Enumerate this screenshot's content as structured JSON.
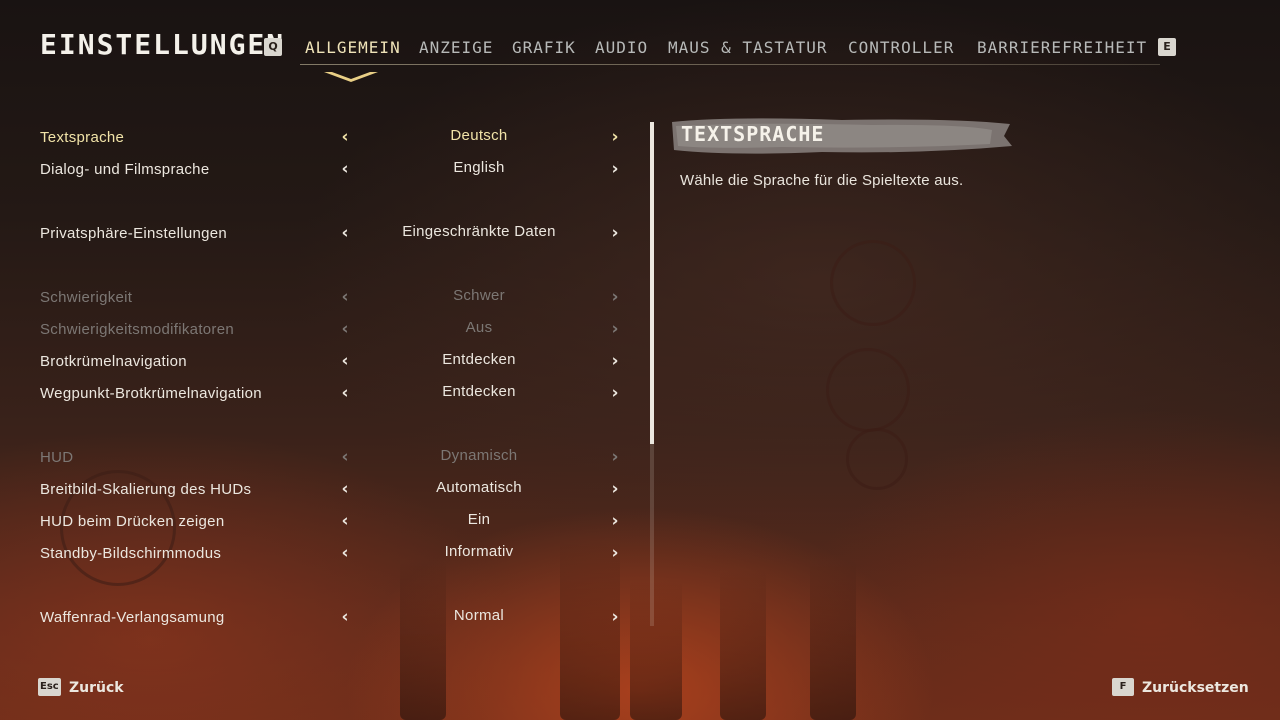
{
  "header": {
    "title": "EINSTELLUNGEN",
    "prev_tab_key": "Q",
    "next_tab_key": "E",
    "tabs": [
      {
        "label": "ALLGEMEIN",
        "active": true
      },
      {
        "label": "ANZEIGE",
        "active": false
      },
      {
        "label": "GRAFIK",
        "active": false
      },
      {
        "label": "AUDIO",
        "active": false
      },
      {
        "label": "MAUS & TASTATUR",
        "active": false
      },
      {
        "label": "CONTROLLER",
        "active": false
      },
      {
        "label": "BARRIEREFREIHEIT",
        "active": false
      }
    ]
  },
  "settings": [
    {
      "label": "Textsprache",
      "value": "Deutsch",
      "state": "selected"
    },
    {
      "label": "Dialog- und Filmsprache",
      "value": "English",
      "state": "normal"
    },
    {
      "label": "Privatsphäre-Einstellungen",
      "value": "Eingeschränkte Daten",
      "state": "normal"
    },
    {
      "label": "Schwierigkeit",
      "value": "Schwer",
      "state": "disabled"
    },
    {
      "label": "Schwierigkeitsmodifikatoren",
      "value": "Aus",
      "state": "disabled"
    },
    {
      "label": "Brotkrümelnavigation",
      "value": "Entdecken",
      "state": "normal"
    },
    {
      "label": "Wegpunkt-Brotkrümelnavigation",
      "value": "Entdecken",
      "state": "normal"
    },
    {
      "label": "HUD",
      "value": "Dynamisch",
      "state": "disabled"
    },
    {
      "label": "Breitbild-Skalierung des HUDs",
      "value": "Automatisch",
      "state": "normal"
    },
    {
      "label": "HUD beim Drücken zeigen",
      "value": "Ein",
      "state": "normal"
    },
    {
      "label": "Standby-Bildschirmmodus",
      "value": "Informativ",
      "state": "normal"
    },
    {
      "label": "Waffenrad-Verlangsamung",
      "value": "Normal",
      "state": "normal"
    }
  ],
  "arrows": {
    "left": "‹",
    "right": "›"
  },
  "description": {
    "title": "TEXTSPRACHE",
    "text": "Wähle die Sprache für die Spieltexte aus."
  },
  "footer": {
    "back": {
      "key": "Esc",
      "label": "Zurück"
    },
    "reset": {
      "key": "F",
      "label": "Zurücksetzen"
    }
  },
  "colors": {
    "accent": "#f1e3a8",
    "text": "#ece7df",
    "disabled": "#7c7774"
  }
}
